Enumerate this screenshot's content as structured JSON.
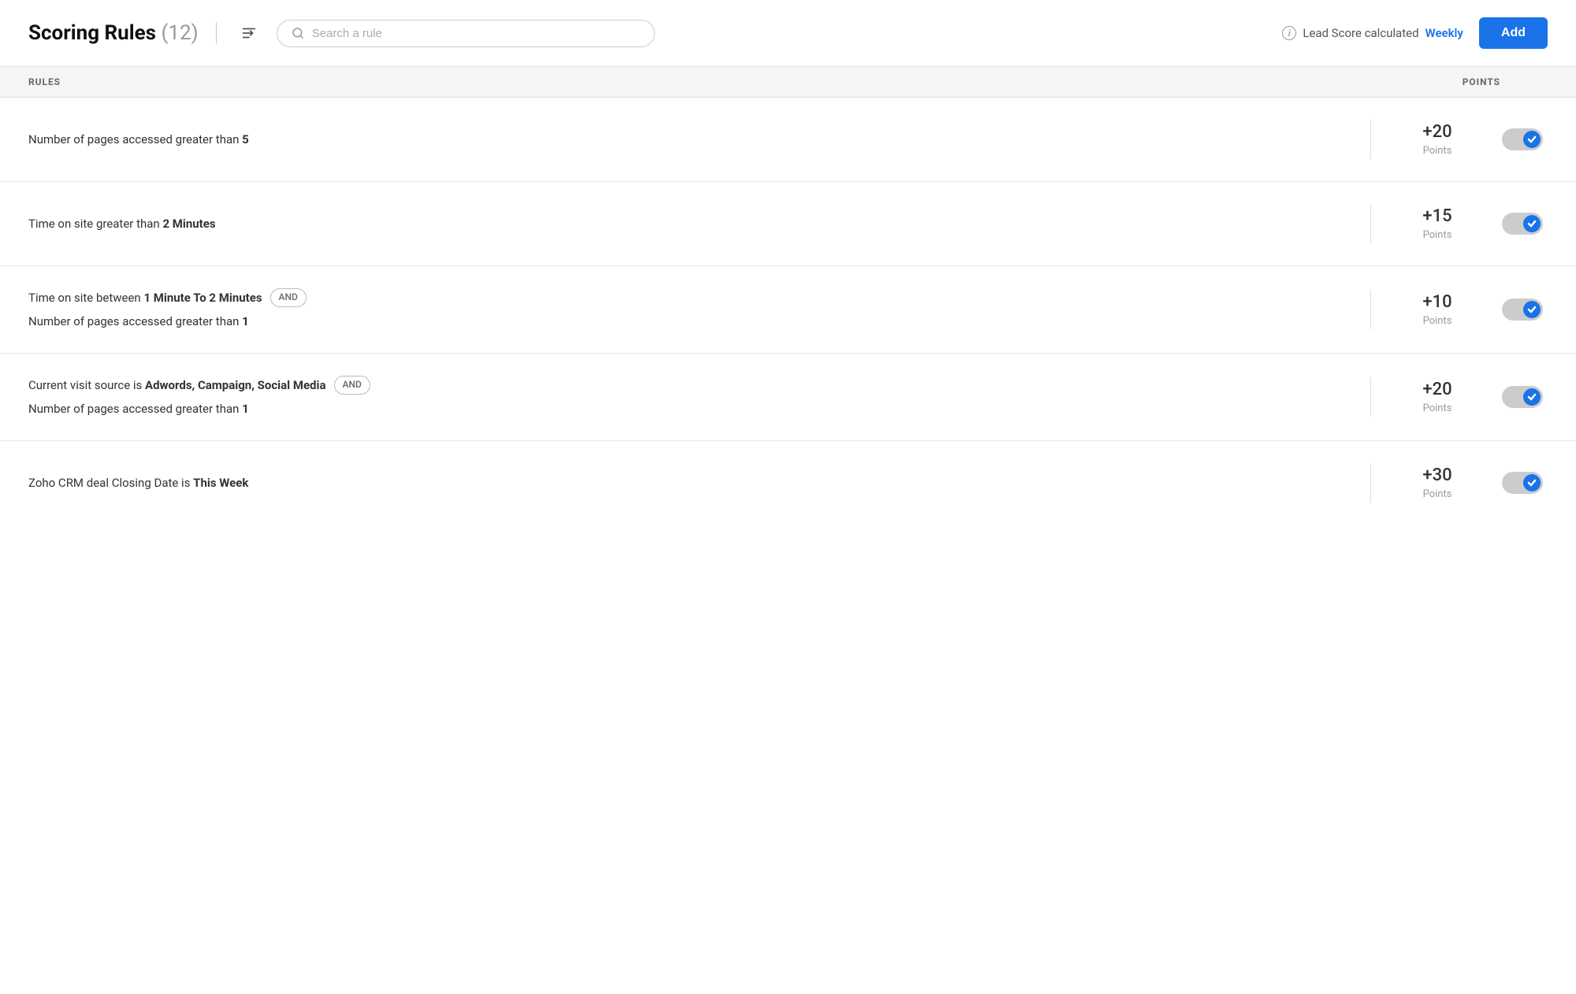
{
  "header": {
    "title": "Scoring Rules",
    "count": "(12)",
    "search_placeholder": "Search a rule",
    "lead_score_text": "Lead Score calculated",
    "weekly_label": "Weekly",
    "add_button_label": "Add"
  },
  "table": {
    "col_rules_label": "RULES",
    "col_points_label": "POINTS"
  },
  "rules": [
    {
      "id": 1,
      "lines": [
        {
          "text_prefix": "Number of pages accessed greater than ",
          "text_bold": "5",
          "and_badge": null
        }
      ],
      "points": "+20",
      "points_label": "Points",
      "enabled": true
    },
    {
      "id": 2,
      "lines": [
        {
          "text_prefix": "Time on site greater than ",
          "text_bold": "2 Minutes",
          "and_badge": null
        }
      ],
      "points": "+15",
      "points_label": "Points",
      "enabled": true
    },
    {
      "id": 3,
      "lines": [
        {
          "text_prefix": "Time on site between ",
          "text_bold": "1 Minute To 2 Minutes",
          "and_badge": "AND"
        },
        {
          "text_prefix": "Number of pages accessed greater than ",
          "text_bold": "1",
          "and_badge": null
        }
      ],
      "points": "+10",
      "points_label": "Points",
      "enabled": true
    },
    {
      "id": 4,
      "lines": [
        {
          "text_prefix": "Current visit source is ",
          "text_bold": "Adwords, Campaign, Social Media",
          "and_badge": "AND"
        },
        {
          "text_prefix": "Number of pages accessed greater than ",
          "text_bold": "1",
          "and_badge": null
        }
      ],
      "points": "+20",
      "points_label": "Points",
      "enabled": true
    },
    {
      "id": 5,
      "lines": [
        {
          "text_prefix": "Zoho CRM deal Closing Date is ",
          "text_bold": "This Week",
          "and_badge": null
        }
      ],
      "points": "+30",
      "points_label": "Points",
      "enabled": true
    }
  ]
}
